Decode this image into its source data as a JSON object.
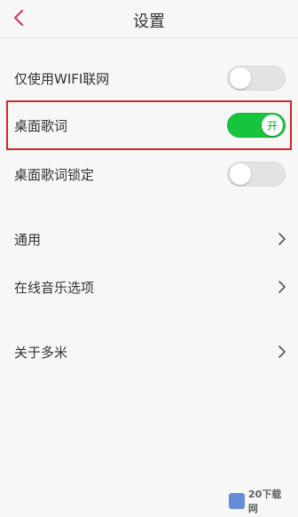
{
  "header": {
    "title": "设置"
  },
  "settings": {
    "wifi_only": {
      "label": "仅使用WIFI联网",
      "enabled": false
    },
    "desktop_lyrics": {
      "label": "桌面歌词",
      "enabled": true,
      "toggle_text": "开"
    },
    "desktop_lyrics_lock": {
      "label": "桌面歌词锁定",
      "enabled": false
    },
    "general": {
      "label": "通用"
    },
    "online_music": {
      "label": "在线音乐选项"
    },
    "about": {
      "label": "关于多米"
    }
  },
  "watermark": {
    "text": "20下载网"
  },
  "colors": {
    "accent_red": "#d2242a",
    "toggle_on": "#17c43e",
    "back_arrow": "#d23a6a"
  }
}
